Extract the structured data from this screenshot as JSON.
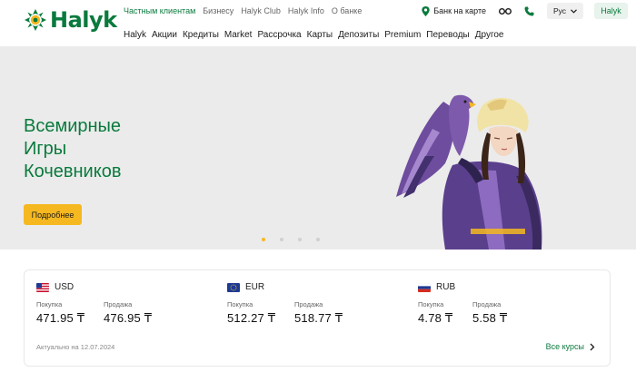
{
  "brand": {
    "name": "Halyk",
    "color": "#0a7a3d",
    "accent": "#f5b820"
  },
  "topnav": [
    "Частным клиентам",
    "Бизнесу",
    "Halyk Club",
    "Halyk Info",
    "О банке"
  ],
  "mainnav": [
    "Halyk",
    "Акции",
    "Кредиты",
    "Market",
    "Рассрочка",
    "Карты",
    "Депозиты",
    "Premium",
    "Переводы",
    "Другое"
  ],
  "tools": {
    "map_label": "Банк на карте",
    "lang": "Рус",
    "halyk_button": "Halyk",
    "icons": [
      "map-pin-icon",
      "glasses-icon",
      "phone-icon",
      "chevron-down-icon"
    ]
  },
  "hero": {
    "title_lines": [
      "Всемирные",
      "Игры",
      "Кочевников"
    ],
    "button": "Подробнее",
    "slides": 5,
    "active_slide": 1
  },
  "rates": {
    "buy_label": "Покупка",
    "sell_label": "Продажа",
    "currencies": [
      {
        "code": "USD",
        "buy": "471.95 ₸",
        "sell": "476.95 ₸"
      },
      {
        "code": "EUR",
        "buy": "512.27 ₸",
        "sell": "518.77 ₸"
      },
      {
        "code": "RUB",
        "buy": "4.78 ₸",
        "sell": "5.58 ₸"
      }
    ],
    "updated": "Актуально на 12.07.2024",
    "all_link": "Все курсы"
  }
}
